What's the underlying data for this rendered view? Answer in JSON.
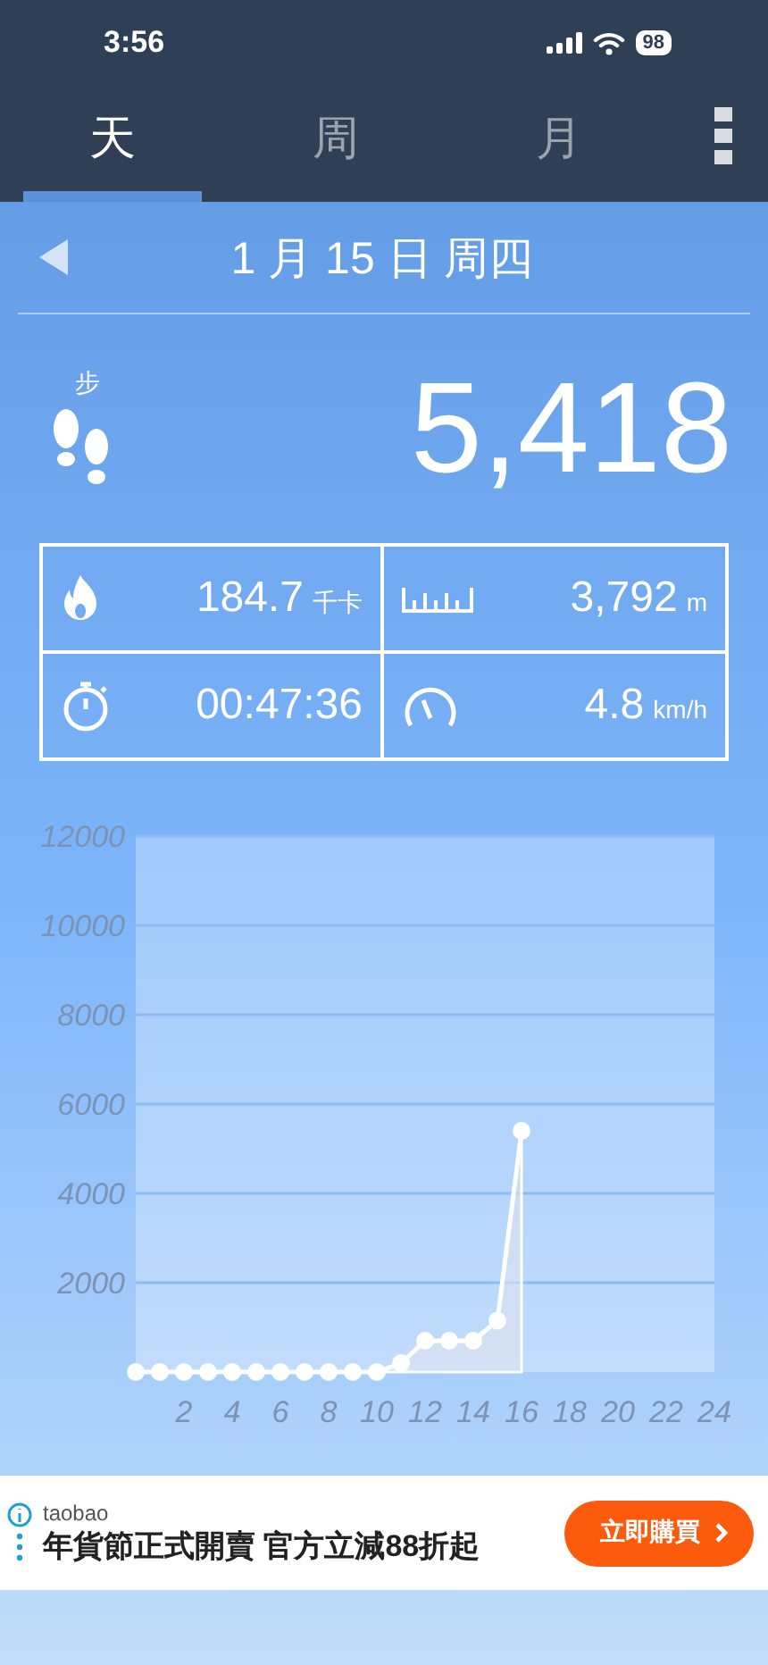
{
  "status_bar": {
    "time": "3:56",
    "battery": "98"
  },
  "tabs": [
    {
      "label": "天",
      "selected": true
    },
    {
      "label": "周",
      "selected": false
    },
    {
      "label": "月",
      "selected": false
    }
  ],
  "date": "1 月 15 日 周四",
  "steps": {
    "label": "步",
    "value": "5,418"
  },
  "stats": [
    {
      "kind": "calories",
      "value": "184.7",
      "unit": "千卡"
    },
    {
      "kind": "distance",
      "value": "3,792",
      "unit": "m"
    },
    {
      "kind": "duration",
      "value": "00:47:36"
    },
    {
      "kind": "speed",
      "value": "4.8",
      "unit": "km/h"
    }
  ],
  "chart": {
    "chart_data": {
      "type": "line",
      "x": [
        0,
        1,
        2,
        3,
        4,
        5,
        6,
        7,
        8,
        9,
        10,
        11,
        12,
        13,
        14,
        15,
        16
      ],
      "series": [
        {
          "color": "#ffffff",
          "marker": true,
          "values": [
            0,
            0,
            0,
            0,
            0,
            0,
            0,
            0,
            0,
            0,
            0,
            200,
            700,
            700,
            700,
            1150,
            5400
          ]
        }
      ],
      "grid": true,
      "xlim": [
        0,
        24
      ],
      "ylim": [
        0,
        12000
      ],
      "xticks": [
        2,
        4,
        6,
        8,
        10,
        12,
        14,
        16,
        18,
        20,
        22,
        24
      ],
      "yticks": [
        2000,
        4000,
        6000,
        8000,
        10000,
        12000
      ]
    }
  },
  "ad": {
    "advertiser": "taobao",
    "headline": "年貨節正式開賣 官方立減88折起",
    "button": "立即購買"
  }
}
